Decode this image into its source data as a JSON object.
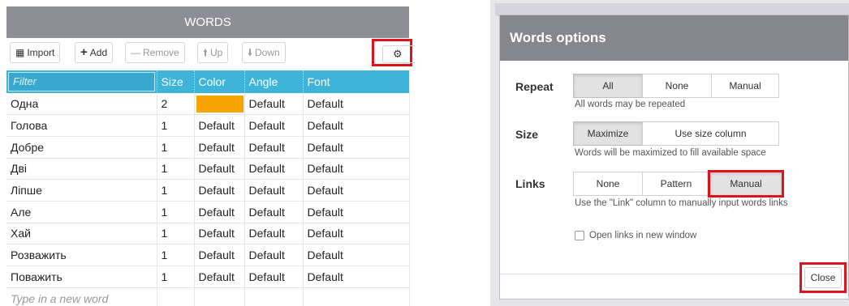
{
  "words_panel": {
    "title": "WORDS",
    "toolbar": {
      "import": "Import",
      "add": "Add",
      "remove": "Remove",
      "up": "Up",
      "down": "Down"
    },
    "columns": {
      "filter_placeholder": "Filter",
      "size": "Size",
      "color": "Color",
      "angle": "Angle",
      "font": "Font"
    },
    "rows": [
      {
        "word": "Одна",
        "size": "2",
        "color": "",
        "color_swatch": "#f9a500",
        "angle": "Default",
        "font": "Default"
      },
      {
        "word": "Голова",
        "size": "1",
        "color": "Default",
        "angle": "Default",
        "font": "Default"
      },
      {
        "word": "Добре",
        "size": "1",
        "color": "Default",
        "angle": "Default",
        "font": "Default"
      },
      {
        "word": "Дві",
        "size": "1",
        "color": "Default",
        "angle": "Default",
        "font": "Default"
      },
      {
        "word": "Ліпше",
        "size": "1",
        "color": "Default",
        "angle": "Default",
        "font": "Default"
      },
      {
        "word": "Але",
        "size": "1",
        "color": "Default",
        "angle": "Default",
        "font": "Default"
      },
      {
        "word": "Хай",
        "size": "1",
        "color": "Default",
        "angle": "Default",
        "font": "Default"
      },
      {
        "word": "Розважить",
        "size": "1",
        "color": "Default",
        "angle": "Default",
        "font": "Default"
      },
      {
        "word": "Поважить",
        "size": "1",
        "color": "Default",
        "angle": "Default",
        "font": "Default"
      }
    ],
    "new_word_placeholder": "Type in a new word"
  },
  "dialog": {
    "title": "Words options",
    "repeat": {
      "label": "Repeat",
      "options": [
        "All",
        "None",
        "Manual"
      ],
      "selected": "All",
      "hint": "All words may be repeated"
    },
    "size": {
      "label": "Size",
      "options": [
        "Maximize",
        "Use size column"
      ],
      "selected": "Maximize",
      "hint": "Words will be maximized to fill available space"
    },
    "links": {
      "label": "Links",
      "options": [
        "None",
        "Pattern",
        "Manual"
      ],
      "selected": "Manual",
      "hint": "Use the \"Link\" column to manually input words links",
      "open_new_window_label": "Open links in new window",
      "open_new_window_checked": false
    },
    "close_label": "Close"
  },
  "colors": {
    "header_gray": "#8e8e95",
    "table_header_blue": "#3fb4da",
    "highlight_red": "#e0121c",
    "swatch_orange": "#f9a500"
  }
}
